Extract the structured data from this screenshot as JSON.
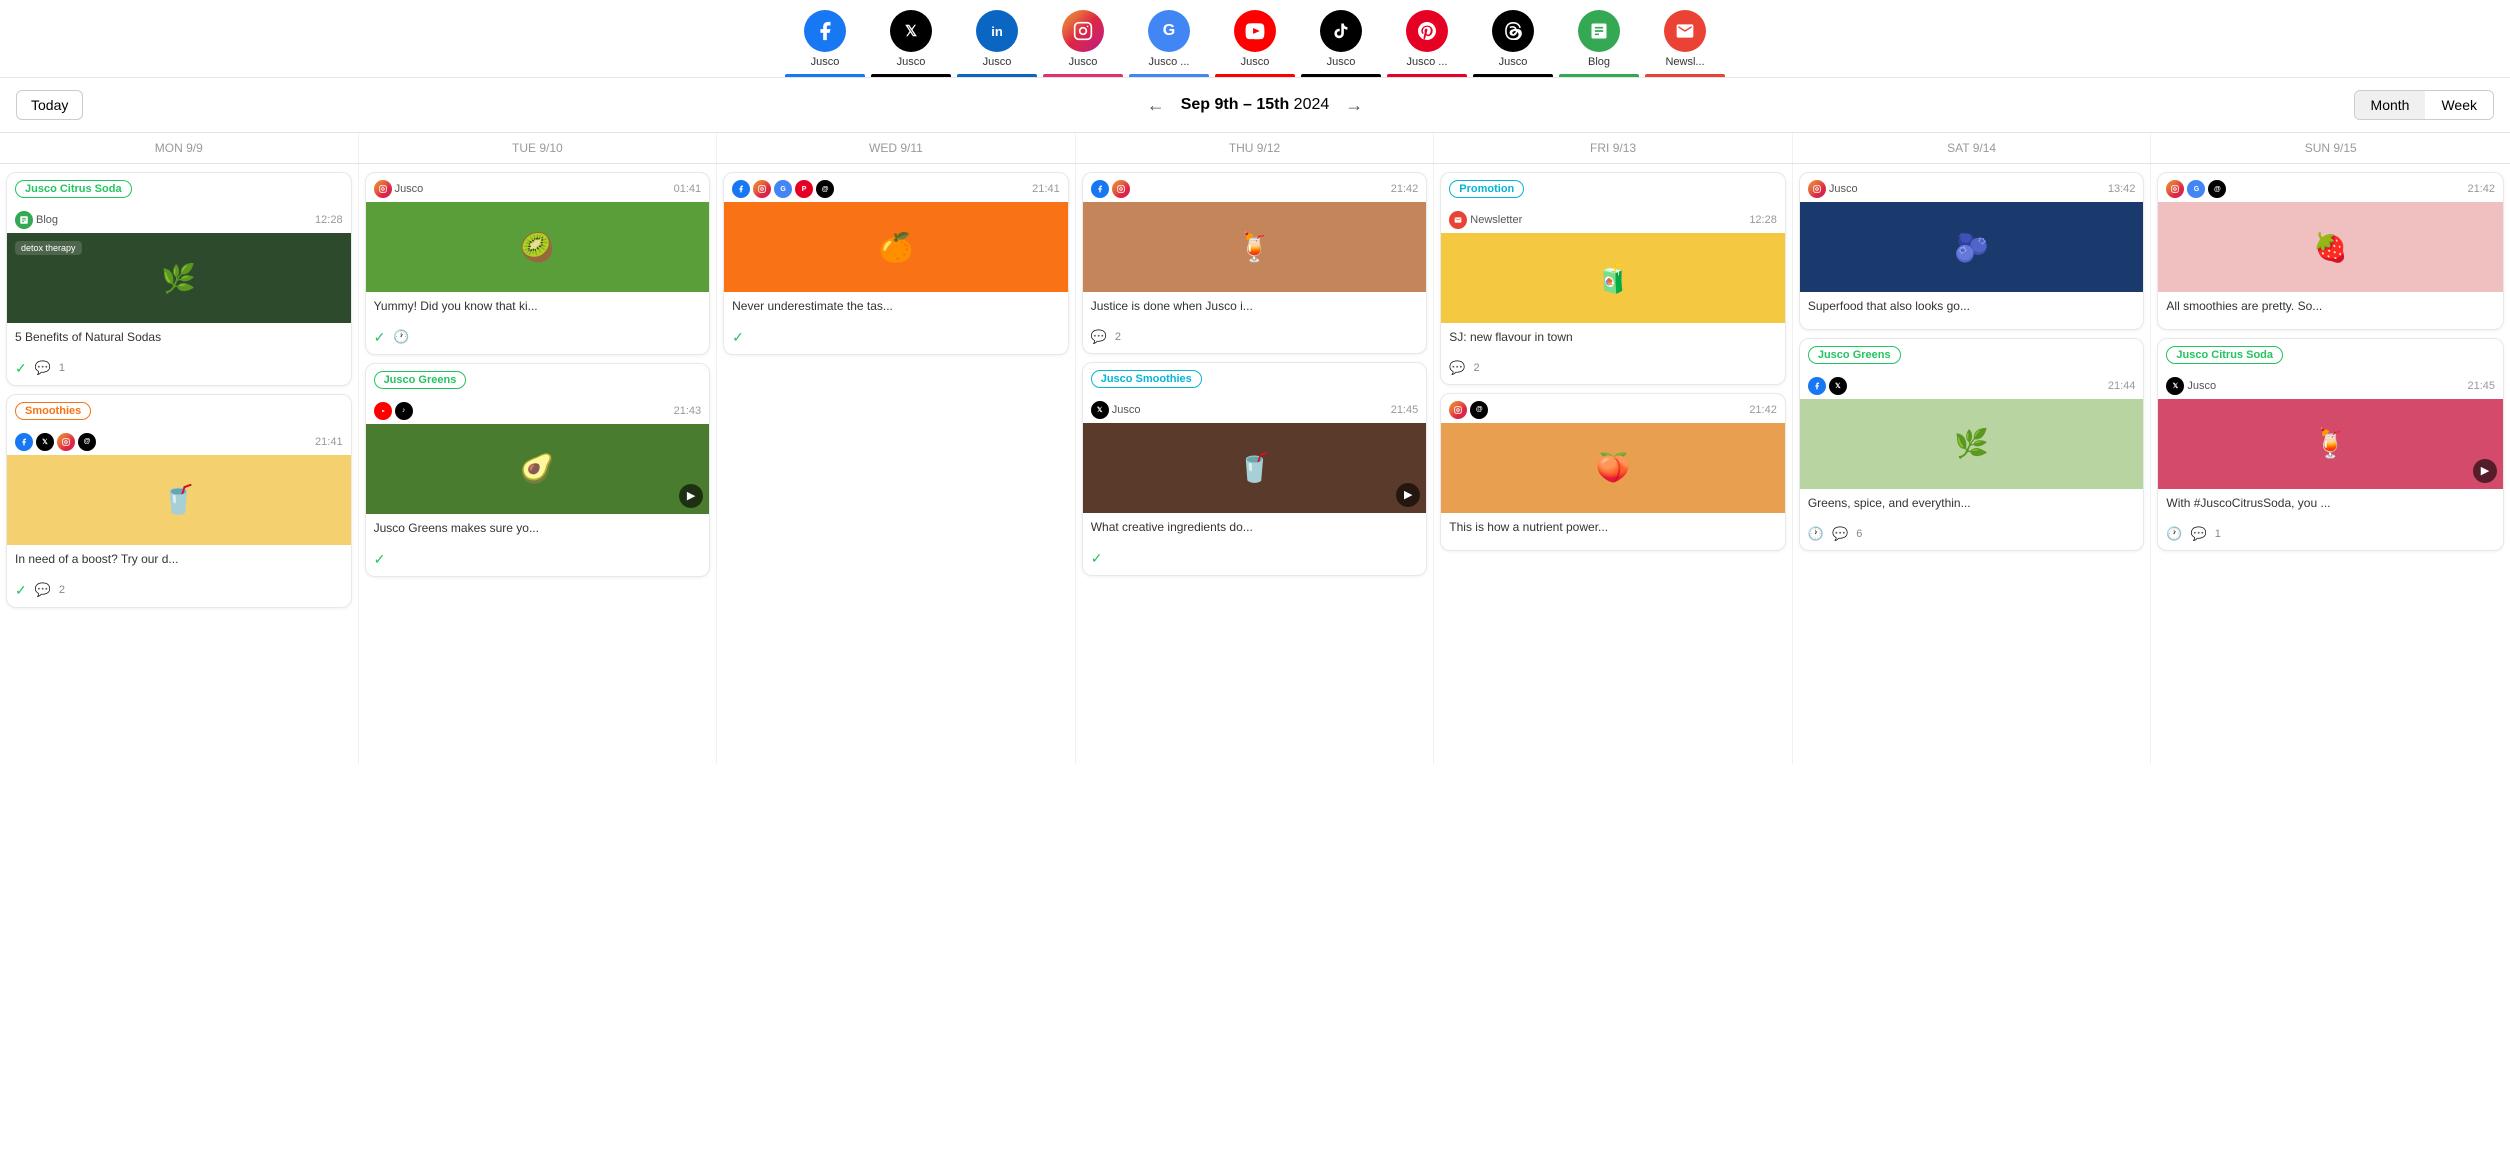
{
  "channels": [
    {
      "id": "facebook",
      "label": "Jusco",
      "color": "#1877F2",
      "letter": "f",
      "underline": "#1877F2"
    },
    {
      "id": "twitter",
      "label": "Jusco",
      "color": "#000000",
      "letter": "𝕏",
      "underline": "#000000"
    },
    {
      "id": "linkedin",
      "label": "Jusco",
      "color": "#0A66C2",
      "letter": "in",
      "underline": "#0A66C2"
    },
    {
      "id": "instagram",
      "label": "Jusco",
      "color": "#E1306C",
      "letter": "▣",
      "underline": "#E1306C"
    },
    {
      "id": "google",
      "label": "Jusco ...",
      "color": "#4285F4",
      "letter": "G",
      "underline": "#4285F4"
    },
    {
      "id": "youtube",
      "label": "Jusco",
      "color": "#FF0000",
      "letter": "▶",
      "underline": "#FF0000"
    },
    {
      "id": "tiktok",
      "label": "Jusco",
      "color": "#000000",
      "letter": "♪",
      "underline": "#000000"
    },
    {
      "id": "pinterest",
      "label": "Jusco ...",
      "color": "#E60023",
      "letter": "P",
      "underline": "#E60023"
    },
    {
      "id": "threads",
      "label": "Jusco",
      "color": "#000000",
      "letter": "@",
      "underline": "#000000"
    },
    {
      "id": "blog",
      "label": "Blog",
      "color": "#34A853",
      "letter": "B",
      "underline": "#34A853"
    },
    {
      "id": "newsletter",
      "label": "Newsl...",
      "color": "#EA4335",
      "letter": "✉",
      "underline": "#EA4335"
    }
  ],
  "header": {
    "today_label": "Today",
    "date_range": "Sep 9th - 15th 2024",
    "month_label": "Month",
    "week_label": "Week"
  },
  "days": [
    {
      "short": "MON 9/9"
    },
    {
      "short": "TUE 9/10"
    },
    {
      "short": "WED 9/11"
    },
    {
      "short": "THU 9/12"
    },
    {
      "short": "FRI 9/13"
    },
    {
      "short": "SAT 9/14"
    },
    {
      "short": "SUN 9/15"
    }
  ],
  "cards": {
    "mon": [
      {
        "badge": "Jusco Citrus Soda",
        "badge_type": "citrus",
        "channel_icon": "blog",
        "channel_name": "Blog",
        "time": "12:28",
        "img_bg": "#2d4a2d",
        "img_emoji": "🌿",
        "text": "5 Benefits of Natural Sodas",
        "has_check": true,
        "comment_count": "1"
      },
      {
        "badge": "Smoothies",
        "badge_type": "smoothies",
        "icons": [
          "facebook",
          "twitter",
          "instagram",
          "threads"
        ],
        "time": "21:41",
        "img_bg": "#f5d06e",
        "img_emoji": "🥤",
        "text": "In need of a boost? Try our d...",
        "has_check": true,
        "comment_count": "2"
      }
    ],
    "tue": [
      {
        "channel_icon": "instagram",
        "channel_name": "Jusco",
        "time": "01:41",
        "img_bg": "#5a9e3a",
        "img_emoji": "🥝",
        "text": "Yummy! Did you know that ki...",
        "has_check": true,
        "has_clock": true
      },
      {
        "badge": "Jusco Greens",
        "badge_type": "greens",
        "icons": [
          "youtube",
          "tiktok"
        ],
        "time": "21:43",
        "img_bg": "#4a7c2f",
        "img_emoji": "🥑",
        "has_video": true,
        "text": "Jusco Greens makes sure yo...",
        "has_check": true
      }
    ],
    "wed": [
      {
        "icons": [
          "facebook",
          "instagram",
          "google",
          "pinterest",
          "threads"
        ],
        "time": "21:41",
        "img_bg": "#f97316",
        "img_emoji": "🍊",
        "text": "Never underestimate the tas...",
        "has_check": true
      }
    ],
    "thu": [
      {
        "icons": [
          "facebook",
          "instagram"
        ],
        "time": "21:42",
        "img_bg": "#c4855a",
        "img_emoji": "🍹",
        "text": "Justice is done when Jusco i...",
        "comment_count": "2"
      },
      {
        "badge": "Jusco Smoothies",
        "badge_type": "smoothies-blue",
        "channel_icon": "twitter",
        "channel_name": "Jusco",
        "time": "21:45",
        "img_bg": "#5a3a2a",
        "img_emoji": "🥤",
        "has_video": true,
        "text": "What creative ingredients do...",
        "has_check": true
      }
    ],
    "fri": [
      {
        "badge": "Promotion",
        "badge_type": "promotion",
        "channel_icon": "newsletter",
        "channel_name": "Newsletter",
        "time": "12:28",
        "img_bg": "#f5c842",
        "img_emoji": "🧃",
        "text": "SJ: new flavour in town",
        "comment_count": "2"
      },
      {
        "icons": [
          "instagram",
          "threads"
        ],
        "time": "21:42",
        "img_bg": "#e8a050",
        "img_emoji": "🍑",
        "text": "This is how a nutrient power...",
        "comment_count": ""
      }
    ],
    "sat": [
      {
        "channel_icon": "instagram",
        "channel_name": "Jusco",
        "time": "13:42",
        "img_bg": "#1a3a6e",
        "img_emoji": "🫐",
        "text": "Superfood that also looks go...",
        "comment_count": ""
      },
      {
        "badge": "Jusco Greens",
        "badge_type": "greens",
        "icons": [
          "facebook",
          "twitter"
        ],
        "time": "21:44",
        "img_bg": "#b8d4a0",
        "img_emoji": "🌿",
        "text": "Greens, spice, and everythin...",
        "has_clock": true,
        "comment_count": "6"
      }
    ],
    "sun": [
      {
        "icons": [
          "instagram",
          "google",
          "threads"
        ],
        "time": "21:42",
        "img_bg": "#f0c0c0",
        "img_emoji": "🍓",
        "text": "All smoothies are pretty. So...",
        "comment_count": ""
      },
      {
        "badge": "Jusco Citrus Soda",
        "badge_type": "citrus",
        "channel_icon": "twitter",
        "channel_name": "Jusco",
        "time": "21:45",
        "img_bg": "#d44a6a",
        "img_emoji": "🍹",
        "has_video": true,
        "text": "With #JuscoCitrusSoda, you ...",
        "has_clock": true,
        "comment_count": "1"
      }
    ]
  },
  "icons": {
    "facebook": {
      "color": "#1877F2",
      "symbol": "f"
    },
    "twitter": {
      "color": "#000000",
      "symbol": "𝕏"
    },
    "instagram": {
      "color": "#E1306C",
      "symbol": "▣"
    },
    "google": {
      "color": "#4285F4",
      "symbol": "G"
    },
    "pinterest": {
      "color": "#E60023",
      "symbol": "P"
    },
    "threads": {
      "color": "#000000",
      "symbol": "@"
    },
    "youtube": {
      "color": "#FF0000",
      "symbol": "▶"
    },
    "tiktok": {
      "color": "#000000",
      "symbol": "♪"
    },
    "blog": {
      "color": "#34A853",
      "symbol": "B"
    },
    "newsletter": {
      "color": "#EA4335",
      "symbol": "✉"
    }
  }
}
